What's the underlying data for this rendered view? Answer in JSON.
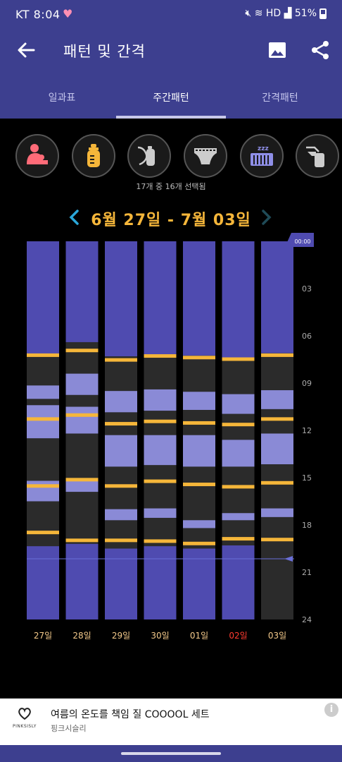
{
  "status_bar": {
    "carrier": "KT",
    "time": "8:04",
    "signal_text": "HD",
    "battery": "51%"
  },
  "header": {
    "title": "패턴 및 간격"
  },
  "tabs": [
    {
      "label": "일과표",
      "active": false
    },
    {
      "label": "주간패턴",
      "active": true
    },
    {
      "label": "간격패턴",
      "active": false
    }
  ],
  "categories": [
    {
      "icon": "breastfeeding-icon",
      "selected": true,
      "color": "#ff6b78"
    },
    {
      "icon": "bottle-icon",
      "selected": true,
      "color": "#f5b63a"
    },
    {
      "icon": "pumped-milk-icon",
      "selected": false,
      "color": "#cccccc"
    },
    {
      "icon": "diaper-icon",
      "selected": false,
      "color": "#cccccc"
    },
    {
      "icon": "sleep-icon",
      "selected": true,
      "color": "#8f8fe8"
    },
    {
      "icon": "breast-pump-icon",
      "selected": false,
      "color": "#cccccc"
    }
  ],
  "selection_text": "17개 중 16개 선택됨",
  "date_range": "6월 27일 - 7월 03일",
  "chart_data": {
    "type": "timeline",
    "y_ticks": [
      "00:00",
      "03",
      "06",
      "09",
      "12",
      "15",
      "18",
      "21",
      "24"
    ],
    "y_range_hours": [
      0,
      24
    ],
    "now_hour": 20.15,
    "colors": {
      "sleep": "#4f4bb0",
      "nap": "#8a8ad6",
      "feed": "#f5b63a",
      "awake": "#2b2b2b",
      "future": "#2b2b2b"
    },
    "days": [
      {
        "label": "27일",
        "color": "#f3c98a",
        "sleep": [
          [
            0,
            7.25
          ],
          [
            19.35,
            24
          ]
        ],
        "naps": [
          [
            9.15,
            10
          ],
          [
            10.4,
            12.5
          ],
          [
            15.2,
            16.5
          ]
        ],
        "feeds": [
          7.25,
          11.3,
          15.55,
          18.5
        ]
      },
      {
        "label": "28일",
        "color": "#f3c98a",
        "sleep": [
          [
            0,
            6.4
          ],
          [
            19.2,
            24
          ]
        ],
        "naps": [
          [
            8.4,
            9.75
          ],
          [
            10.5,
            12.2
          ],
          [
            15.05,
            15.9
          ]
        ],
        "feeds": [
          6.95,
          11.05,
          15.15,
          19.0
        ]
      },
      {
        "label": "29일",
        "color": "#f3c98a",
        "sleep": [
          [
            0,
            7.3
          ],
          [
            19.5,
            24
          ]
        ],
        "naps": [
          [
            9.5,
            10.85
          ],
          [
            12.3,
            14.3
          ],
          [
            17.0,
            17.7
          ]
        ],
        "feeds": [
          7.55,
          11.6,
          15.55,
          19.0
        ]
      },
      {
        "label": "30일",
        "color": "#f3c98a",
        "sleep": [
          [
            0,
            7.25
          ],
          [
            19.35,
            24
          ]
        ],
        "naps": [
          [
            9.4,
            10.75
          ],
          [
            12.3,
            14.2
          ],
          [
            16.95,
            17.55
          ]
        ],
        "feeds": [
          7.3,
          11.45,
          15.25,
          19.05
        ]
      },
      {
        "label": "01일",
        "color": "#f3c98a",
        "sleep": [
          [
            0,
            7.25
          ],
          [
            19.5,
            24
          ]
        ],
        "naps": [
          [
            9.55,
            10.7
          ],
          [
            12.3,
            14.3
          ],
          [
            17.7,
            18.2
          ]
        ],
        "feeds": [
          7.4,
          11.55,
          15.45,
          19.2
        ]
      },
      {
        "label": "02일",
        "color": "#ff3b30",
        "sleep": [
          [
            0,
            7.4
          ],
          [
            19.3,
            24
          ]
        ],
        "naps": [
          [
            9.7,
            10.95
          ],
          [
            12.6,
            14.3
          ],
          [
            17.25,
            17.7
          ]
        ],
        "feeds": [
          7.5,
          11.65,
          15.6,
          18.9
        ]
      },
      {
        "label": "03일",
        "color": "#f3c98a",
        "sleep": [
          [
            0,
            7.1
          ]
        ],
        "naps": [
          [
            9.45,
            10.65
          ],
          [
            12.2,
            14.15
          ],
          [
            16.95,
            17.5
          ]
        ],
        "feeds": [
          7.25,
          11.3,
          15.35,
          18.95
        ]
      }
    ]
  },
  "ad": {
    "brand": "PINKSISLY",
    "title": "여름의 온도를 책임 질 COOOOL 세트",
    "subtitle": "핑크시슬리",
    "info": "i"
  }
}
